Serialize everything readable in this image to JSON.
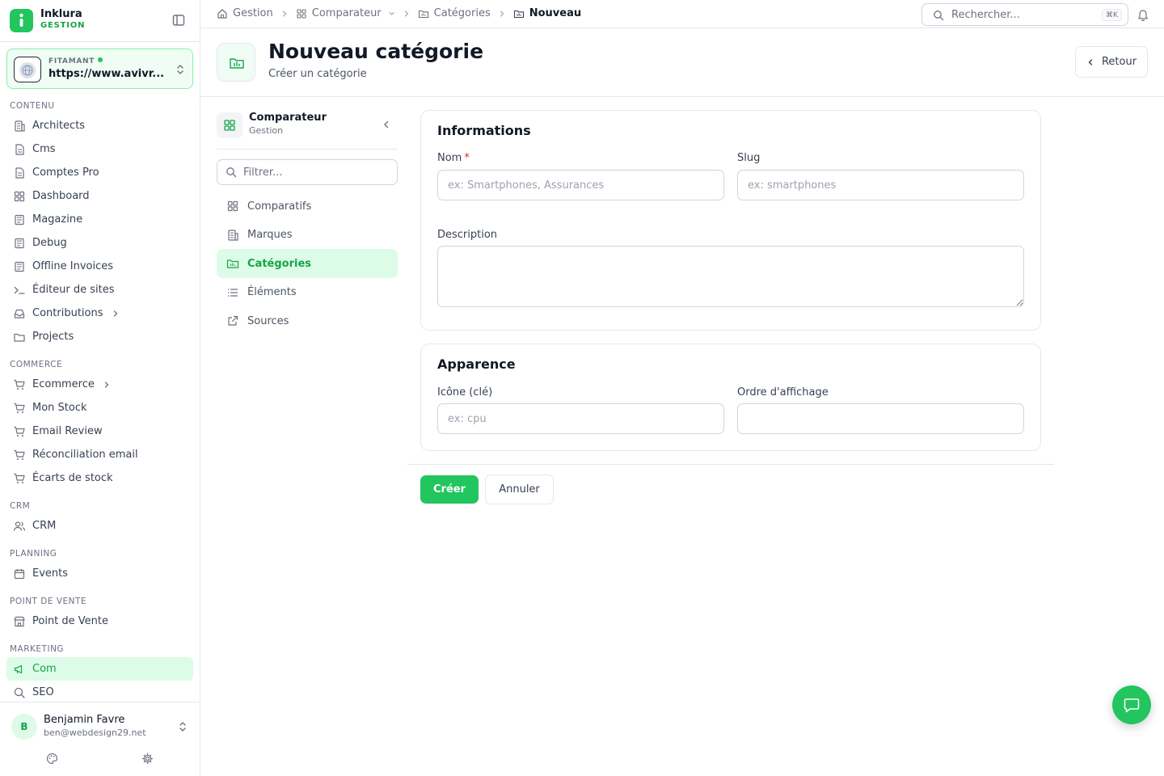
{
  "brand": {
    "name": "Inklura",
    "subtitle": "GESTION"
  },
  "site": {
    "label": "FITAMANT",
    "url": "https://www.avivr..."
  },
  "sidebar": {
    "sections": [
      {
        "title": "CONTENU",
        "items": [
          {
            "label": "Architects",
            "icon": "building-icon"
          },
          {
            "label": "Cms",
            "icon": "document-icon"
          },
          {
            "label": "Comptes Pro",
            "icon": "document-icon"
          },
          {
            "label": "Dashboard",
            "icon": "grid-icon"
          },
          {
            "label": "Magazine",
            "icon": "newspaper-icon"
          },
          {
            "label": "Debug",
            "icon": "newspaper-icon"
          },
          {
            "label": "Offline Invoices",
            "icon": "newspaper-icon"
          },
          {
            "label": "Éditeur de sites",
            "icon": "terminal-icon"
          },
          {
            "label": "Contributions",
            "icon": "inbox-icon",
            "expandable": true
          },
          {
            "label": "Projects",
            "icon": "folder-icon"
          }
        ]
      },
      {
        "title": "COMMERCE",
        "items": [
          {
            "label": "Ecommerce",
            "icon": "cart-icon",
            "expandable": true
          },
          {
            "label": "Mon Stock",
            "icon": "cart-icon"
          },
          {
            "label": "Email Review",
            "icon": "cart-icon"
          },
          {
            "label": "Réconciliation email",
            "icon": "cart-icon"
          },
          {
            "label": "Écarts de stock",
            "icon": "cart-icon"
          }
        ]
      },
      {
        "title": "CRM",
        "items": [
          {
            "label": "CRM",
            "icon": "users-icon"
          }
        ]
      },
      {
        "title": "PLANNING",
        "items": [
          {
            "label": "Events",
            "icon": "calendar-icon"
          }
        ]
      },
      {
        "title": "POINT DE VENTE",
        "items": [
          {
            "label": "Point de Vente",
            "icon": "store-icon"
          }
        ]
      },
      {
        "title": "MARKETING",
        "items": [
          {
            "label": "Com",
            "icon": "megaphone-icon",
            "active": true
          },
          {
            "label": "SEO",
            "icon": "search-icon"
          }
        ]
      }
    ]
  },
  "user": {
    "initial": "B",
    "name": "Benjamin Favre",
    "email": "ben@webdesign29.net"
  },
  "breadcrumb": {
    "items": [
      "Gestion",
      "Comparateur",
      "Catégories",
      "Nouveau"
    ]
  },
  "search": {
    "placeholder": "Rechercher...",
    "shortcut": "⌘K"
  },
  "header": {
    "title": "Nouveau catégorie",
    "subtitle": "Créer un catégorie",
    "back_label": "Retour"
  },
  "subnav": {
    "title": "Comparateur",
    "subtitle": "Gestion",
    "filter_placeholder": "Filtrer...",
    "items": [
      {
        "label": "Comparatifs",
        "icon": "grid-icon"
      },
      {
        "label": "Marques",
        "icon": "building-icon"
      },
      {
        "label": "Catégories",
        "icon": "folder-chart-icon",
        "active": true
      },
      {
        "label": "Éléments",
        "icon": "list-icon"
      },
      {
        "label": "Sources",
        "icon": "external-link-icon"
      }
    ]
  },
  "form": {
    "info": {
      "title": "Informations",
      "nom_label": "Nom",
      "nom_required": "*",
      "nom_placeholder": "ex: Smartphones, Assurances",
      "nom_value": "",
      "slug_label": "Slug",
      "slug_placeholder": "ex: smartphones",
      "slug_value": "",
      "description_label": "Description",
      "description_value": ""
    },
    "appearance": {
      "title": "Apparence",
      "icon_label": "Icône (clé)",
      "icon_placeholder": "ex: cpu",
      "icon_value": "",
      "order_label": "Ordre d'affichage",
      "order_value": ""
    },
    "submit_label": "Créer",
    "cancel_label": "Annuler"
  },
  "colors": {
    "accent": "#22c55e",
    "accent_dark": "#16a34a",
    "accent_light": "#dcfce7",
    "border": "#e5e7eb"
  }
}
